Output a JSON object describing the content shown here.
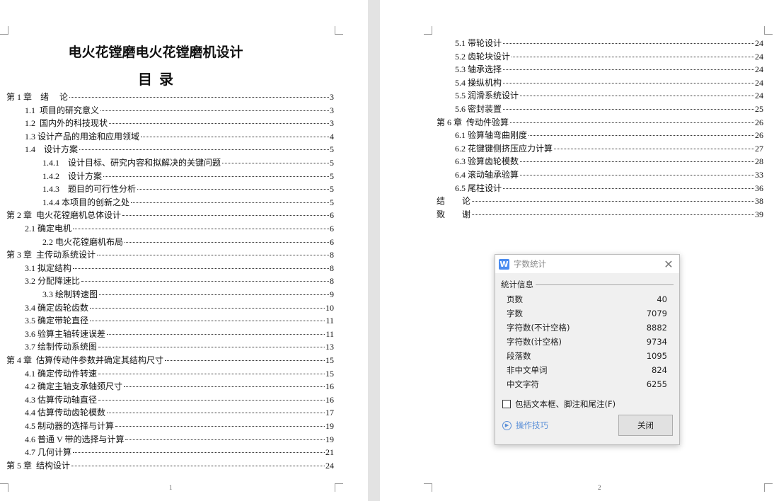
{
  "document": {
    "title": "电火花镗磨电火花镗磨机设计",
    "toc_heading": "目  录"
  },
  "page1": {
    "number": "1",
    "entries": [
      {
        "level": 0,
        "label": "第 1 章　绪　 论",
        "page": "3"
      },
      {
        "level": 1,
        "label": "1.1  项目的研究意义",
        "page": "3"
      },
      {
        "level": 1,
        "label": "1.2  国内外的科技现状",
        "page": "3"
      },
      {
        "level": 1,
        "label": "1.3 设计产品的用途和应用领域",
        "page": "4"
      },
      {
        "level": 1,
        "label": "1.4    设计方案",
        "page": "5"
      },
      {
        "level": 2,
        "label": "1.4.1    设计目标、研究内容和拟解决的关键问题",
        "page": "5"
      },
      {
        "level": 2,
        "label": "1.4.2    设计方案",
        "page": "5"
      },
      {
        "level": 2,
        "label": "1.4.3    题目的可行性分析",
        "page": "5"
      },
      {
        "level": 2,
        "label": "1.4.4 本项目的创新之处",
        "page": "5"
      },
      {
        "level": 0,
        "label": "第 2 章  电火花镗磨机总体设计",
        "page": "6"
      },
      {
        "level": 1,
        "label": "2.1 确定电机",
        "page": "6"
      },
      {
        "level": 2,
        "label": "2.2 电火花镗磨机布局",
        "page": "6"
      },
      {
        "level": 0,
        "label": "第 3 章  主传动系统设计",
        "page": "8"
      },
      {
        "level": 1,
        "label": "3.1 拟定结构",
        "page": "8"
      },
      {
        "level": 1,
        "label": "3.2 分配降速比",
        "page": "8"
      },
      {
        "level": 2,
        "label": "3.3 绘制转速图",
        "page": "9"
      },
      {
        "level": 1,
        "label": "3.4 确定齿轮齿数",
        "page": "10"
      },
      {
        "level": 1,
        "label": "3.5 确定带轮直径",
        "page": "11"
      },
      {
        "level": 1,
        "label": "3.6 验算主轴转速误差",
        "page": "11"
      },
      {
        "level": 1,
        "label": "3.7 绘制传动系统图",
        "page": "13"
      },
      {
        "level": 0,
        "label": "第 4 章  估算传动件参数并确定其结构尺寸",
        "page": "15"
      },
      {
        "level": 1,
        "label": "4.1 确定传动件转速",
        "page": "15"
      },
      {
        "level": 1,
        "label": "4.2 确定主轴支承轴颈尺寸",
        "page": "16"
      },
      {
        "level": 1,
        "label": "4.3 估算传动轴直径",
        "page": "16"
      },
      {
        "level": 1,
        "label": "4.4 估算传动齿轮模数",
        "page": "17"
      },
      {
        "level": 1,
        "label": "4.5 制动器的选择与计算",
        "page": "19"
      },
      {
        "level": 1,
        "label": "4.6 普通 V 带的选择与计算",
        "page": "19"
      },
      {
        "level": 1,
        "label": "4.7 几何计算",
        "page": "21"
      },
      {
        "level": 0,
        "label": "第 5 章  结构设计",
        "page": "24"
      }
    ]
  },
  "page2": {
    "number": "2",
    "entries": [
      {
        "level": 1,
        "label": "5.1 带轮设计",
        "page": "24"
      },
      {
        "level": 1,
        "label": "5.2 齿轮块设计",
        "page": "24"
      },
      {
        "level": 1,
        "label": "5.3 轴承选择",
        "page": "24"
      },
      {
        "level": 1,
        "label": "5.4 操纵机构",
        "page": "24"
      },
      {
        "level": 1,
        "label": "5.5 润滑系统设计",
        "page": "24"
      },
      {
        "level": 1,
        "label": "5.6 密封装置",
        "page": "25"
      },
      {
        "level": 0,
        "label": "第 6 章  传动件验算",
        "page": "26"
      },
      {
        "level": 1,
        "label": "6.1 验算轴弯曲刚度",
        "page": "26"
      },
      {
        "level": 1,
        "label": "6.2 花键键侧挤压应力计算",
        "page": "27"
      },
      {
        "level": 1,
        "label": "6.3 验算齿轮模数",
        "page": "28"
      },
      {
        "level": 1,
        "label": "6.4 滚动轴承验算",
        "page": "33"
      },
      {
        "level": 1,
        "label": "6.5 尾柱设计",
        "page": "36"
      },
      {
        "level": 0,
        "label": "结　　论",
        "page": "38"
      },
      {
        "level": 0,
        "label": "致　　谢",
        "page": "39"
      }
    ]
  },
  "dialog": {
    "logo": "W",
    "title": "字数统计",
    "group_label": "统计信息",
    "stats": [
      {
        "label": "页数",
        "value": "40"
      },
      {
        "label": "字数",
        "value": "7079"
      },
      {
        "label": "字符数(不计空格)",
        "value": "8882"
      },
      {
        "label": "字符数(计空格)",
        "value": "9734"
      },
      {
        "label": "段落数",
        "value": "1095"
      },
      {
        "label": "非中文单词",
        "value": "824"
      },
      {
        "label": "中文字符",
        "value": "6255"
      }
    ],
    "checkbox_label": "包括文本框、脚注和尾注(F)",
    "checkbox_checked": false,
    "tips_label": "操作技巧",
    "close_label": "关闭"
  }
}
